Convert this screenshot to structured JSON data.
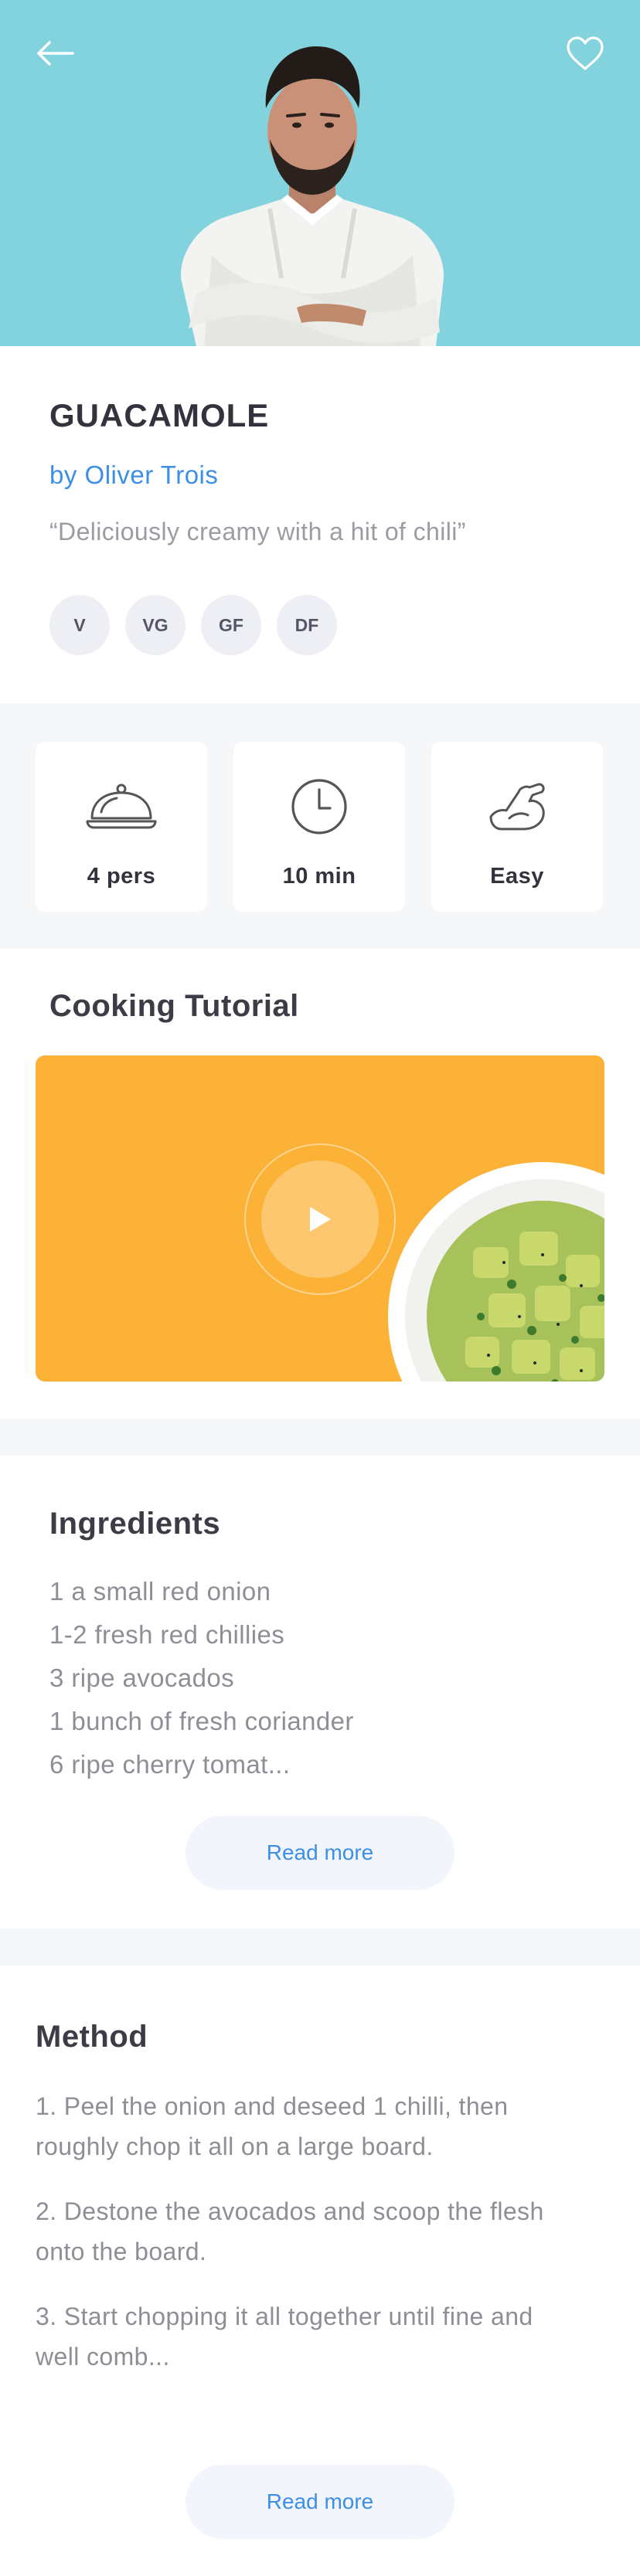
{
  "header": {
    "back_icon": "arrow-left-icon",
    "favorite_icon": "heart-outline-icon",
    "hero_color": "#83d3de"
  },
  "recipe": {
    "title": "GUACAMOLE",
    "author": "by Oliver Trois",
    "tagline": "“Deliciously creamy with a hit of chili”",
    "badges": [
      "V",
      "VG",
      "GF",
      "DF"
    ]
  },
  "stats": [
    {
      "icon": "serving-cloche-icon",
      "label": "4 pers"
    },
    {
      "icon": "clock-icon",
      "label": "10 min"
    },
    {
      "icon": "flexed-arm-icon",
      "label": "Easy"
    }
  ],
  "tutorial": {
    "title": "Cooking Tutorial",
    "play_icon": "play-icon",
    "video_color": "#fbb237"
  },
  "ingredients": {
    "title": "Ingredients",
    "items": [
      "1 a small red onion",
      "1-2 fresh red chillies",
      "3 ripe avocados",
      "1 bunch of fresh coriander",
      "6 ripe cherry tomat..."
    ],
    "read_more": "Read more"
  },
  "method": {
    "title": "Method",
    "steps": [
      "1. Peel the onion and deseed 1 chilli, then roughly chop it all on a large board.",
      "2. Destone the avocados and scoop the flesh onto the board.",
      "3. Start chopping it all together until fine and well comb..."
    ],
    "read_more": "Read more"
  },
  "colors": {
    "accent": "#3d8fe6",
    "muted_text": "#8e8e96",
    "section_bg": "#f6f7f9"
  }
}
